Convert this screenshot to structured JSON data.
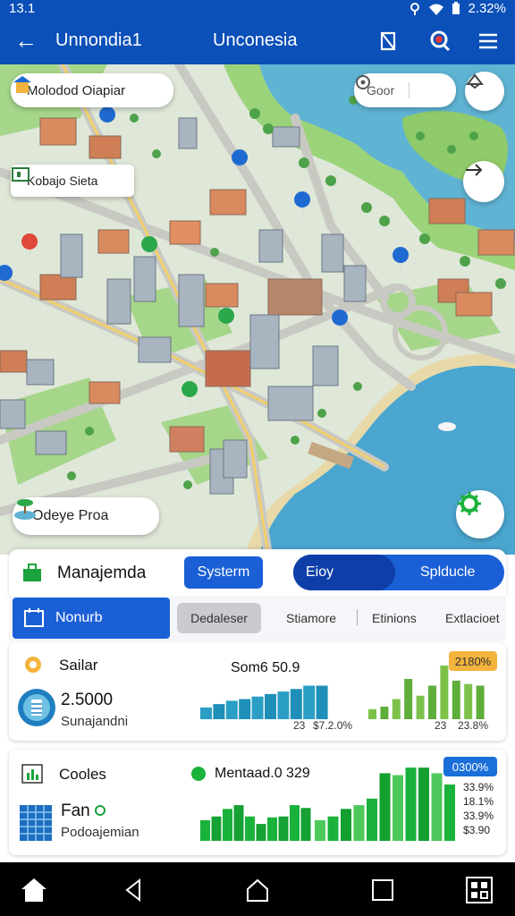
{
  "status": {
    "time": "13.1",
    "battery": "2.32%"
  },
  "appbar": {
    "title_left": "Unnondia1",
    "title_center": "Unconesia"
  },
  "map": {
    "search_pill_label": "Molodod Oiapiar",
    "right_pill_label": "Goor",
    "label_left": "Kobajo Sieta",
    "label_bottom": "Odeye Proa"
  },
  "panel": {
    "section_title": "Manajemda",
    "system_button": "Systerm",
    "toggle_left": "Eioy",
    "toggle_right": "Splducle",
    "tab_active": "Nonurb",
    "tab_2": "Dedaleser",
    "tab_3": "Stiamore",
    "tab_4": "Etinions",
    "tab_5": "Extlacioet"
  },
  "card1": {
    "title": "Sailar",
    "value": "2.5000",
    "sub": "Sunajandni",
    "chart_title": "Som6 50.9",
    "badge": "2180%",
    "axis_left_a": "23",
    "axis_left_b": "$7.2.0%",
    "axis_right_a": "23",
    "axis_right_b": "23.8%"
  },
  "card2": {
    "title": "Cooles",
    "value": "Fan",
    "sub": "Podoajemian",
    "legend": "Mentaad.0 329",
    "badge": "0300%",
    "side_values": [
      "33.9%",
      "18.1%",
      "33.9%",
      "$3.90"
    ]
  },
  "colors": {
    "primary": "#0b4fb8",
    "accent_blue": "#1a5fd6",
    "green": "#19b23a",
    "teal": "#1e9ec0",
    "badge_orange": "#f3b33d"
  },
  "chart_data": [
    {
      "type": "bar",
      "title": "Som6 50.9",
      "series": [
        {
          "values": [
            14,
            18,
            22,
            24,
            27,
            30,
            33,
            36,
            40,
            40
          ]
        },
        {
          "values": [
            12,
            15,
            24,
            48,
            28,
            40,
            64,
            46,
            42,
            40
          ]
        }
      ]
    },
    {
      "type": "bar",
      "title": "Mentaad.0 329",
      "series": [
        {
          "values": [
            22,
            26,
            34,
            38,
            26,
            18,
            25,
            26,
            38,
            35
          ]
        },
        {
          "values": [
            22,
            26,
            34,
            38,
            45,
            72,
            70,
            78,
            78,
            72,
            60
          ]
        }
      ]
    }
  ]
}
